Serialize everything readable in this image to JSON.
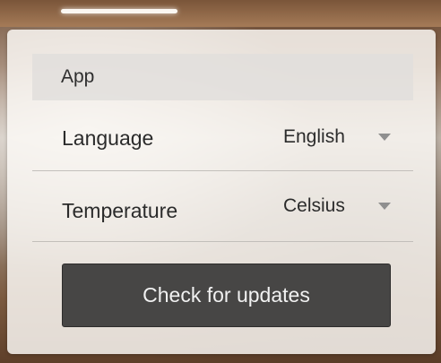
{
  "section": {
    "title": "App"
  },
  "settings": {
    "language": {
      "label": "Language",
      "value": "English",
      "icon": "chevron-down-icon"
    },
    "temperature": {
      "label": "Temperature",
      "value": "Celsius",
      "icon": "chevron-down-icon"
    }
  },
  "actions": {
    "check_updates_label": "Check for updates"
  },
  "colors": {
    "button_background": "#474645",
    "button_text": "#f1f1f1",
    "header_background": "#e1dedc",
    "panel_background": "#fbf9f6",
    "caret": "#8f8f8f"
  }
}
